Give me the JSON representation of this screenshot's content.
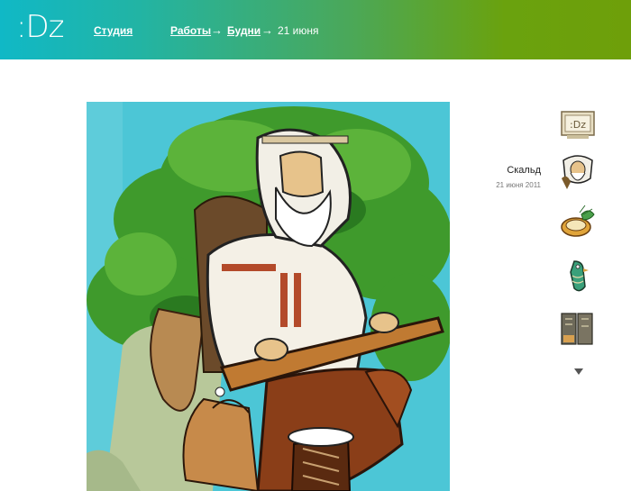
{
  "header": {
    "logo": ":Dz",
    "studio_link": "Студия",
    "breadcrumb": {
      "works": "Работы",
      "sep1": "→",
      "weekdays": "Будни",
      "sep2": "→",
      "current": "21 июня"
    }
  },
  "artwork": {
    "title": "Скальд",
    "date": "21 июня 2011"
  },
  "thumbnails": [
    {
      "icon": "dz-sign-thumbnail"
    },
    {
      "icon": "skald-thumbnail"
    },
    {
      "icon": "plate-thumbnail"
    },
    {
      "icon": "bird-thumbnail"
    },
    {
      "icon": "tablet-thumbnail"
    }
  ],
  "colors": {
    "header_left": "#10b8c6",
    "header_right": "#6e9f0a"
  }
}
